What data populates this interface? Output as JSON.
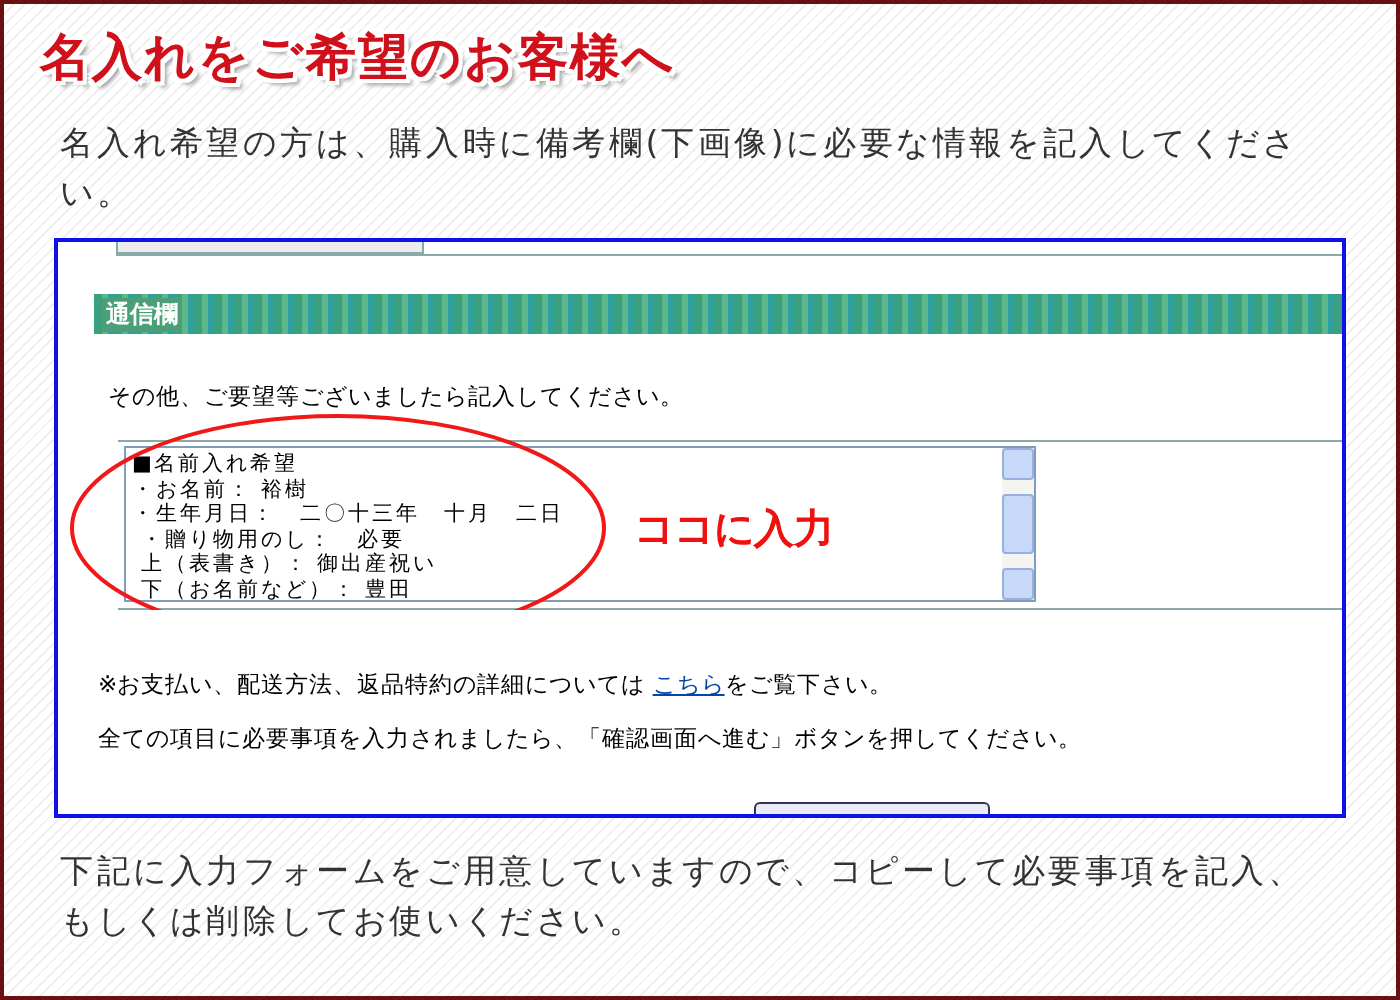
{
  "title": "名入れをご希望のお客様へ",
  "intro": "名入れ希望の方は、購入時に備考欄(下画像)に必要な情報を記入してください。",
  "screenshot": {
    "section_header": "通信欄",
    "prompt": "その他、ご要望等ございましたら記入してください。",
    "memo_lines": [
      "■名前入れ希望",
      "・お名前： 裕樹",
      "・生年月日：　二〇十三年　十月　二日",
      " ・贈り物用のし：　必要",
      " 上（表書き）： 御出産祝い",
      " 下（お名前など）： 豊田"
    ],
    "callout": "ココに入力",
    "note_before_link": "※お支払い、配送方法、返品特約の詳細については ",
    "note_link": "こちら",
    "note_after_link": "をご覧下さい。",
    "instruction": "全ての項目に必要事項を入力されましたら、「確認画面へ進む」ボタンを押してください。"
  },
  "outro": "下記に入力フォームをご用意していますので、コピーして必要事項を記入、もしくは削除してお使いください。"
}
